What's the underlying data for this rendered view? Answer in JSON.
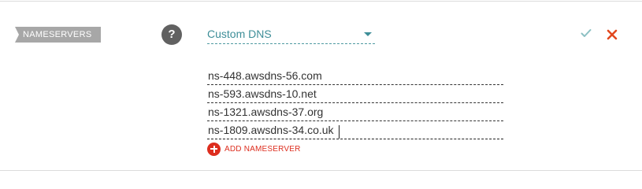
{
  "section": {
    "tag_label": "NAMESERVERS"
  },
  "help": {
    "icon": "question-icon",
    "glyph": "?"
  },
  "dns_type": {
    "selected": "Custom DNS"
  },
  "actions": {
    "confirm_icon": "check-icon",
    "cancel_icon": "close-icon"
  },
  "nameservers": [
    "ns-448.awsdns-56.com",
    "ns-593.awsdns-10.net",
    "ns-1321.awsdns-37.org",
    "ns-1809.awsdns-34.co.uk"
  ],
  "add_nameserver": {
    "label": "ADD NAMESERVER",
    "icon": "plus-circle-icon"
  },
  "colors": {
    "accent": "#3e8e98",
    "danger": "#dd2e1f",
    "tag_background": "#a7a7a7",
    "help_background": "#616161",
    "confirm": "#8cc0c3"
  }
}
